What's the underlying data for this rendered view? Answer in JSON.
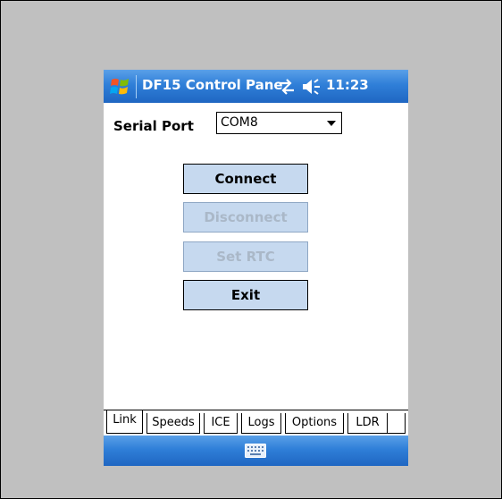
{
  "titlebar": {
    "title": "DF15 Control Pane",
    "time": "11:23"
  },
  "icons": {
    "start": "windows-flag-icon",
    "connectivity": "sync-arrows-icon",
    "volume": "speaker-icon",
    "input": "keyboard-icon"
  },
  "form": {
    "serial_port_label": "Serial Port",
    "serial_port_value": "COM8"
  },
  "buttons": {
    "connect": "Connect",
    "disconnect": "Disconnect",
    "set_rtc": "Set RTC",
    "exit": "Exit"
  },
  "tabs": [
    "Link",
    "Speeds",
    "ICE",
    "Logs",
    "Options",
    "LDR"
  ],
  "colors": {
    "bar_blue": "#2f7fd8",
    "button_fill": "#c6d9ef",
    "background": "#c0c0c0"
  }
}
